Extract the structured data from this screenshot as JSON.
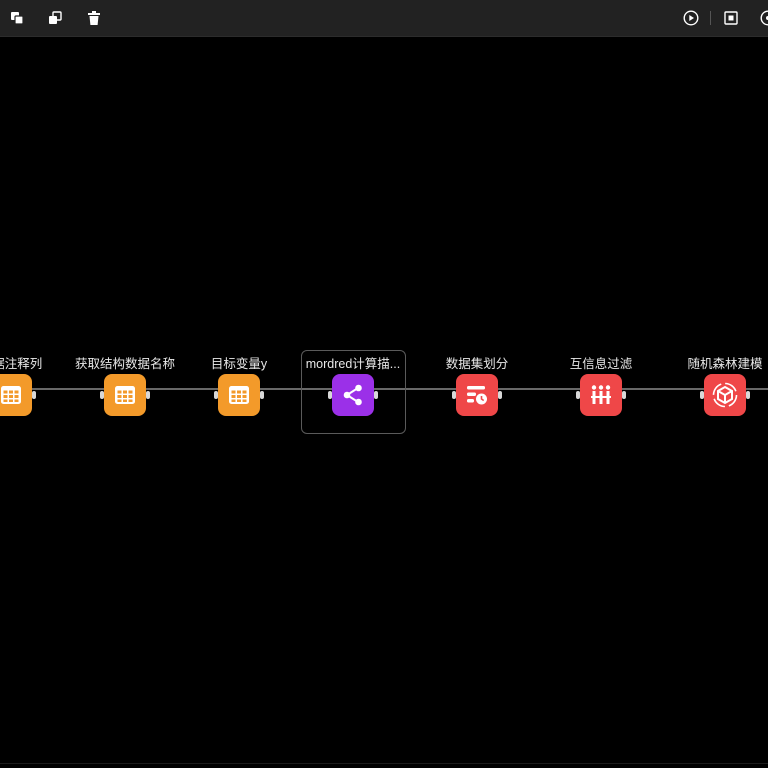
{
  "toolbar": {
    "left_buttons": [
      {
        "name": "copy-icon",
        "title": "复制"
      },
      {
        "name": "paste-icon",
        "title": "粘贴"
      },
      {
        "name": "delete-icon",
        "title": "删除"
      }
    ],
    "right_buttons": [
      {
        "name": "run-icon",
        "title": "运行"
      },
      {
        "name": "fit-view-icon",
        "title": "适应画布"
      },
      {
        "name": "settings-icon",
        "title": "设置"
      }
    ]
  },
  "workflow": {
    "nodes": [
      {
        "label": "数据注释列",
        "color": "orange",
        "icon": "table-icon"
      },
      {
        "label": "获取结构数据名称",
        "color": "orange",
        "icon": "table-icon"
      },
      {
        "label": "目标变量y",
        "color": "orange",
        "icon": "table-icon"
      },
      {
        "label": "mordred计算描...",
        "color": "purple",
        "icon": "share-icon",
        "selected": true
      },
      {
        "label": "数据集划分",
        "color": "red",
        "icon": "split-icon"
      },
      {
        "label": "互信息过滤",
        "color": "red",
        "icon": "filter-icon"
      },
      {
        "label": "随机森林建模",
        "color": "red",
        "icon": "cube-icon"
      }
    ]
  },
  "colors": {
    "orange": "#f39a2a",
    "purple": "#9b30e8",
    "red": "#ef4748",
    "edge": "#8a8a8a"
  }
}
